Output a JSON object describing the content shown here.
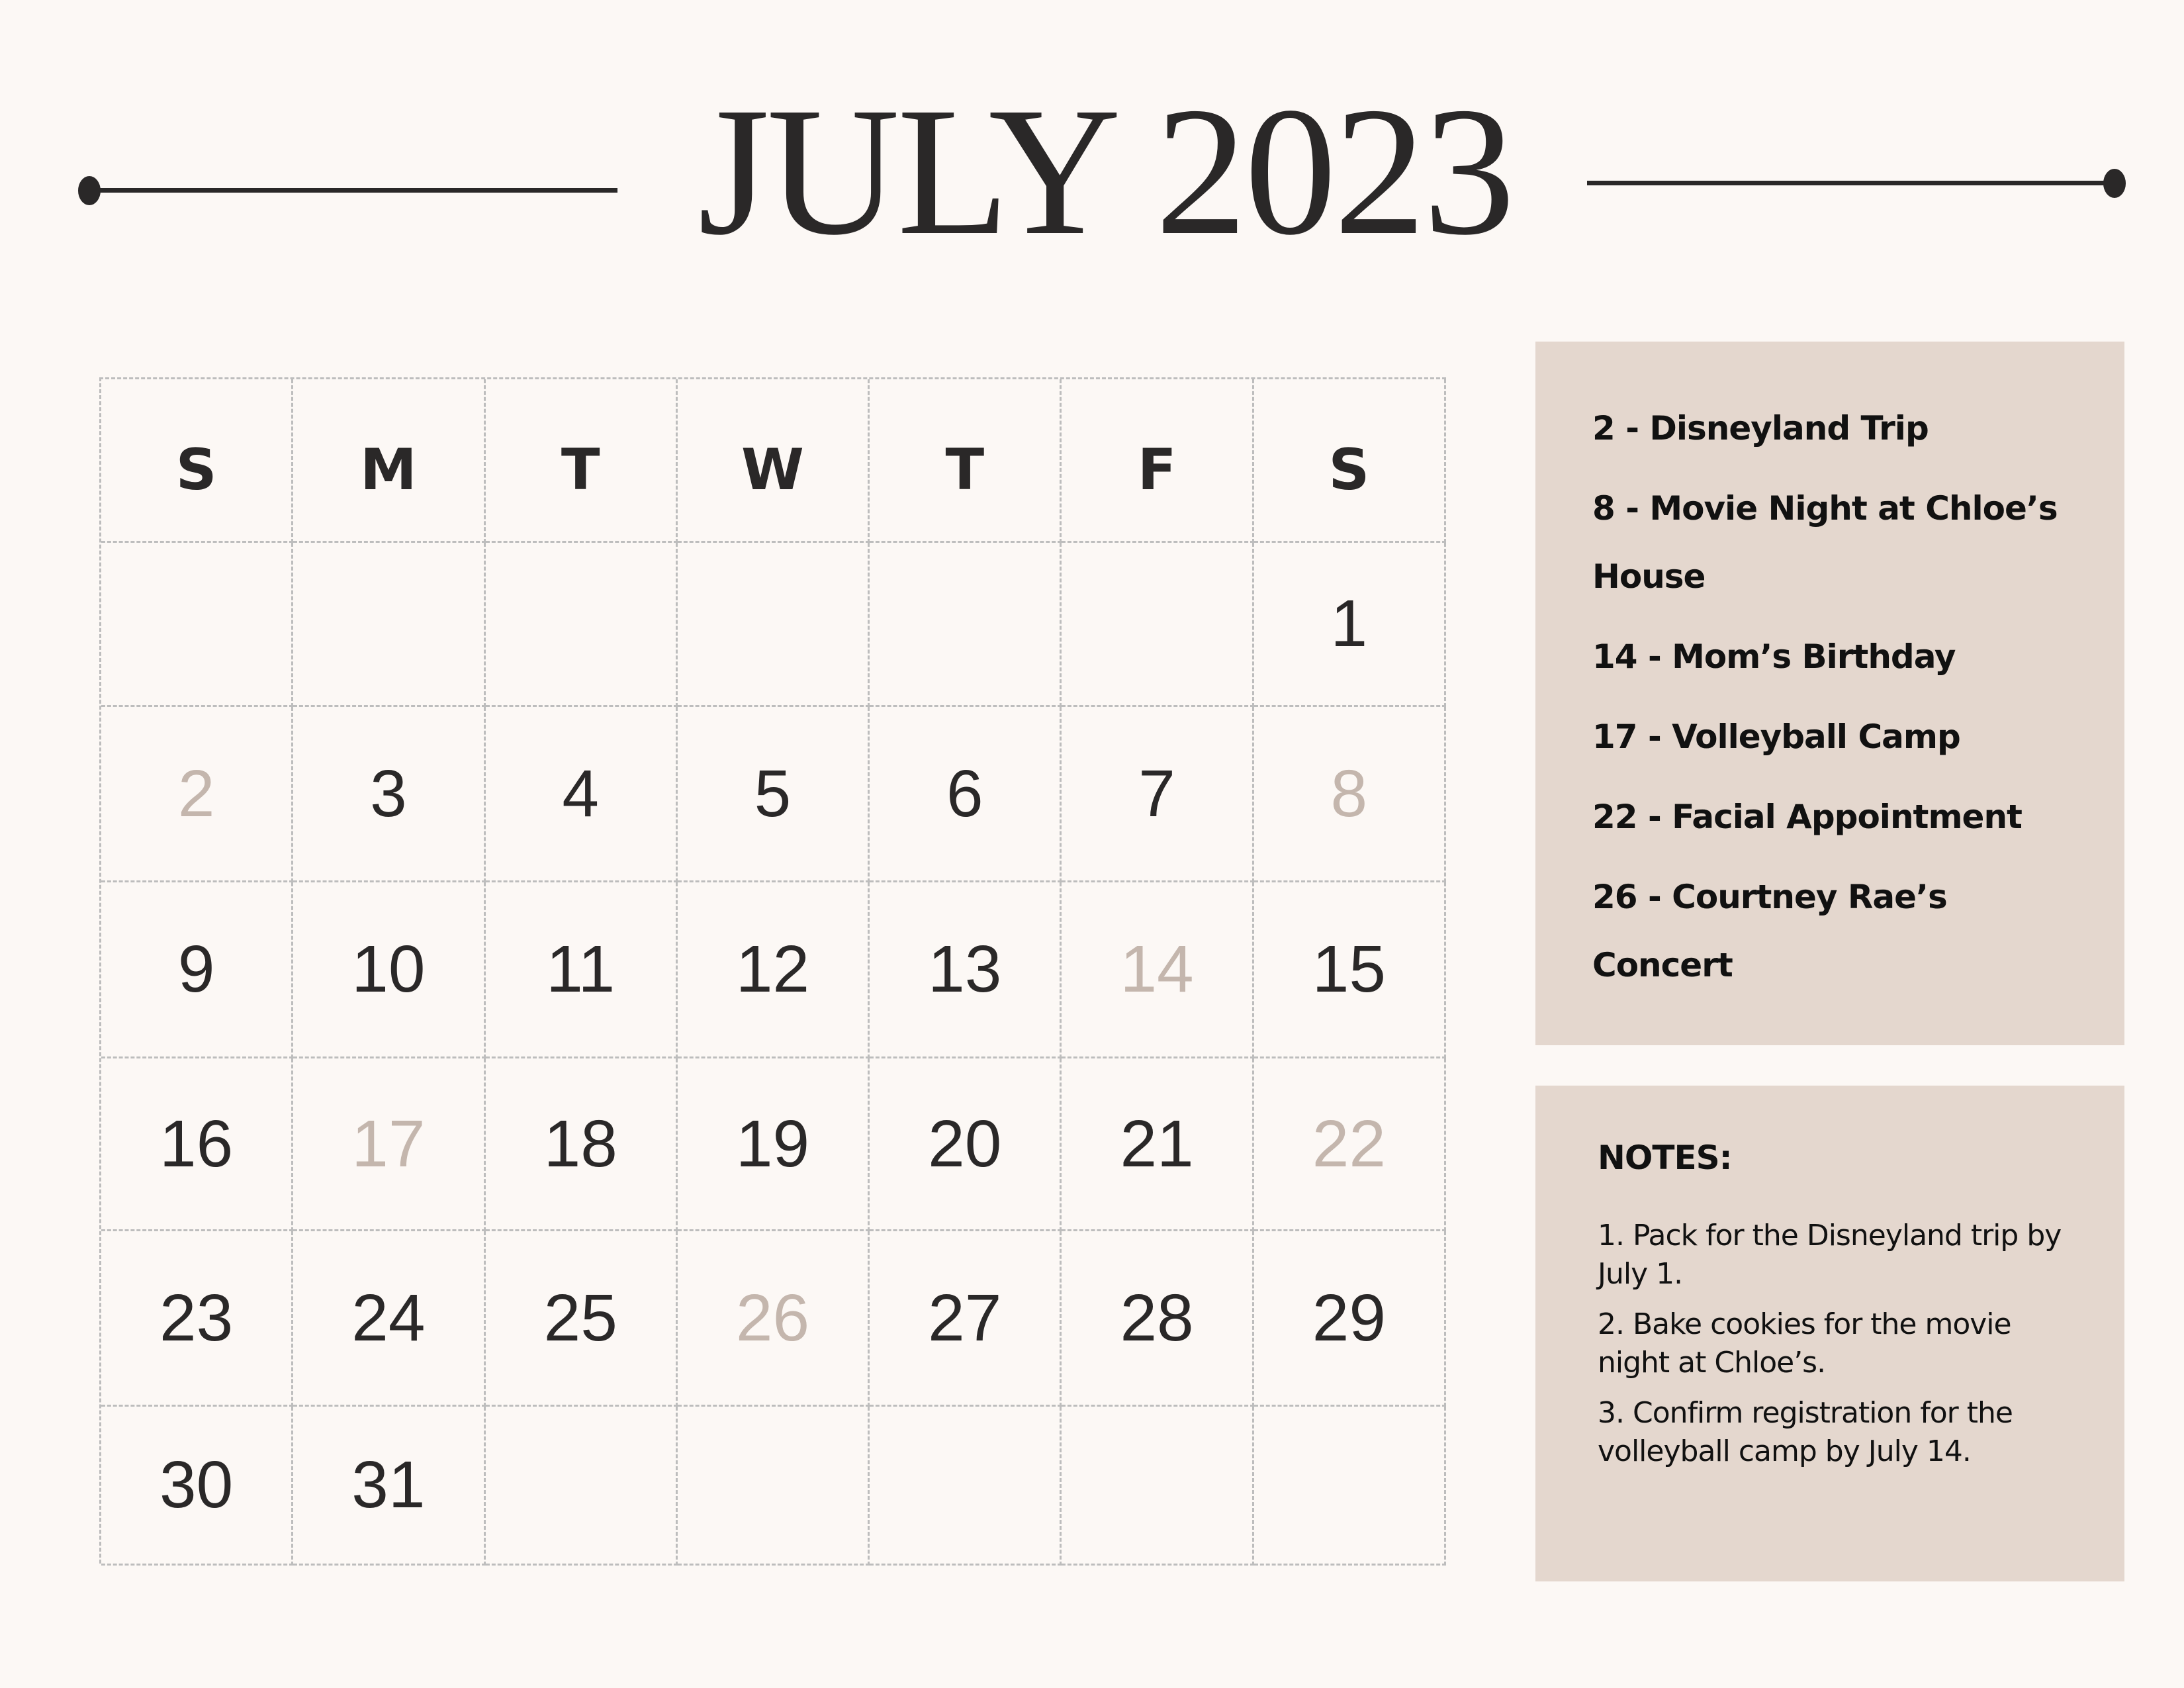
{
  "header": {
    "title": "JULY 2023"
  },
  "calendar": {
    "weekdays": [
      "S",
      "M",
      "T",
      "W",
      "T",
      "F",
      "S"
    ],
    "weeks": [
      [
        "",
        "",
        "",
        "",
        "",
        "",
        "1"
      ],
      [
        "2",
        "3",
        "4",
        "5",
        "6",
        "7",
        "8"
      ],
      [
        "9",
        "10",
        "11",
        "12",
        "13",
        "14",
        "15"
      ],
      [
        "16",
        "17",
        "18",
        "19",
        "20",
        "21",
        "22"
      ],
      [
        "23",
        "24",
        "25",
        "26",
        "27",
        "28",
        "29"
      ],
      [
        "30",
        "31",
        "",
        "",
        "",
        "",
        ""
      ]
    ],
    "highlighted_days": [
      "2",
      "8",
      "14",
      "17",
      "22",
      "26"
    ],
    "colors": {
      "text": "#2a2828",
      "highlight": "#c4b6ad",
      "grid_line": "#bdbdbd",
      "background": "#fcf8f5",
      "panel": "#e4d7ce"
    }
  },
  "events": [
    "2 - Disneyland Trip",
    "8 - Movie Night at Chloe’s House",
    "14 - Mom’s Birthday",
    "17 - Volleyball Camp",
    "22 - Facial Appointment",
    "26 - Courtney Rae’s Concert"
  ],
  "notes": {
    "title": "NOTES:",
    "items": [
      "1. Pack for the Disneyland trip by July 1.",
      "2. Bake cookies for the movie night at Chloe’s.",
      "3. Confirm registration for the volleyball camp by July 14."
    ]
  }
}
